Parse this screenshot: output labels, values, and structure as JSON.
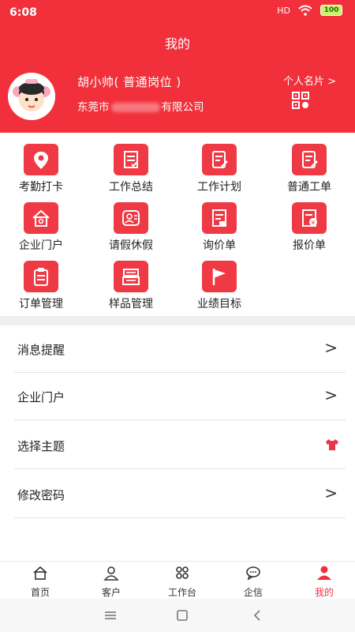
{
  "status_bar": {
    "time": "6:08",
    "signal": "HD",
    "battery": "100"
  },
  "header": {
    "title": "我的",
    "user_name": "胡小帅( 普通岗位 )",
    "company_prefix": "东莞市",
    "company_suffix": "有限公司",
    "card_link": "个人名片 >"
  },
  "grid": {
    "items": [
      {
        "label": "考勤打卡",
        "icon": "location-pin-icon"
      },
      {
        "label": "工作总结",
        "icon": "document-summary-icon"
      },
      {
        "label": "工作计划",
        "icon": "document-edit-icon"
      },
      {
        "label": "普通工单",
        "icon": "document-pen-icon"
      },
      {
        "label": "企业门户",
        "icon": "home-icon"
      },
      {
        "label": "请假休假",
        "icon": "leave-icon"
      },
      {
        "label": "询价单",
        "icon": "inquiry-icon"
      },
      {
        "label": "报价单",
        "icon": "quotation-icon"
      },
      {
        "label": "订单管理",
        "icon": "clipboard-icon"
      },
      {
        "label": "样品管理",
        "icon": "sample-box-icon"
      },
      {
        "label": "业绩目标",
        "icon": "flag-icon"
      }
    ]
  },
  "menu": {
    "items": [
      {
        "label": "消息提醒",
        "trail": ">"
      },
      {
        "label": "企业门户",
        "trail": ">"
      },
      {
        "label": "选择主题",
        "trail": "shirt-icon"
      },
      {
        "label": "修改密码",
        "trail": ">"
      }
    ]
  },
  "tabbar": {
    "items": [
      {
        "label": "首页",
        "icon": "home-outline-icon"
      },
      {
        "label": "客户",
        "icon": "customer-icon"
      },
      {
        "label": "工作台",
        "icon": "workbench-icon"
      },
      {
        "label": "企信",
        "icon": "chat-icon"
      },
      {
        "label": "我的",
        "icon": "person-icon",
        "active": true
      }
    ]
  },
  "colors": {
    "accent": "#f2303c",
    "icon_bg": "#ef3944"
  }
}
